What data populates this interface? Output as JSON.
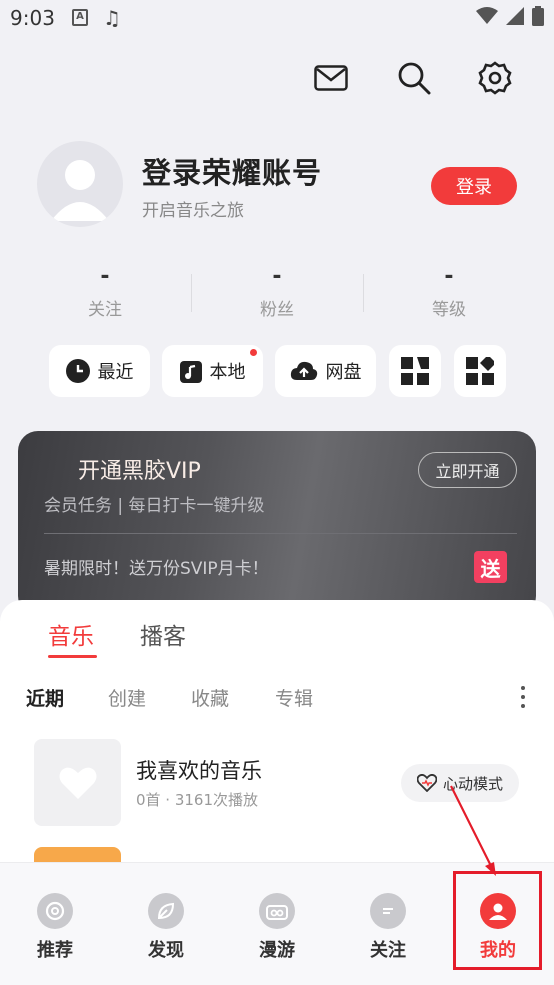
{
  "status_bar": {
    "time": "9:03",
    "input_badge": "A"
  },
  "profile": {
    "title": "登录荣耀账号",
    "subtitle": "开启音乐之旅",
    "login_label": "登录"
  },
  "stats": [
    {
      "value": "-",
      "label": "关注"
    },
    {
      "value": "-",
      "label": "粉丝"
    },
    {
      "value": "-",
      "label": "等级"
    }
  ],
  "quick_buttons": [
    {
      "label": "最近",
      "icon": "clock-icon"
    },
    {
      "label": "本地",
      "icon": "music-note-icon",
      "badge": true
    },
    {
      "label": "网盘",
      "icon": "cloud-upload-icon"
    }
  ],
  "vip": {
    "title": "开通黑胶VIP",
    "subtitle": "会员任务 | 每日打卡一键升级",
    "cta": "立即开通",
    "promo": "暑期限时！送万份SVIP月卡！",
    "gift_badge": "送"
  },
  "tabs": {
    "music": "音乐",
    "podcast": "播客"
  },
  "subtabs": [
    "近期",
    "创建",
    "收藏",
    "专辑"
  ],
  "playlist": {
    "title": "我喜欢的音乐",
    "meta": "0首 · 3161次播放",
    "mode_label": "心动模式"
  },
  "bottom_nav": [
    {
      "label": "推荐",
      "icon": "recommend-icon"
    },
    {
      "label": "发现",
      "icon": "discover-icon"
    },
    {
      "label": "漫游",
      "icon": "roam-icon"
    },
    {
      "label": "关注",
      "icon": "follow-icon"
    },
    {
      "label": "我的",
      "icon": "user-icon",
      "active": true
    }
  ],
  "colors": {
    "accent": "#f23b3b",
    "background": "#f1f1f5",
    "annotation": "#e41c2a"
  }
}
